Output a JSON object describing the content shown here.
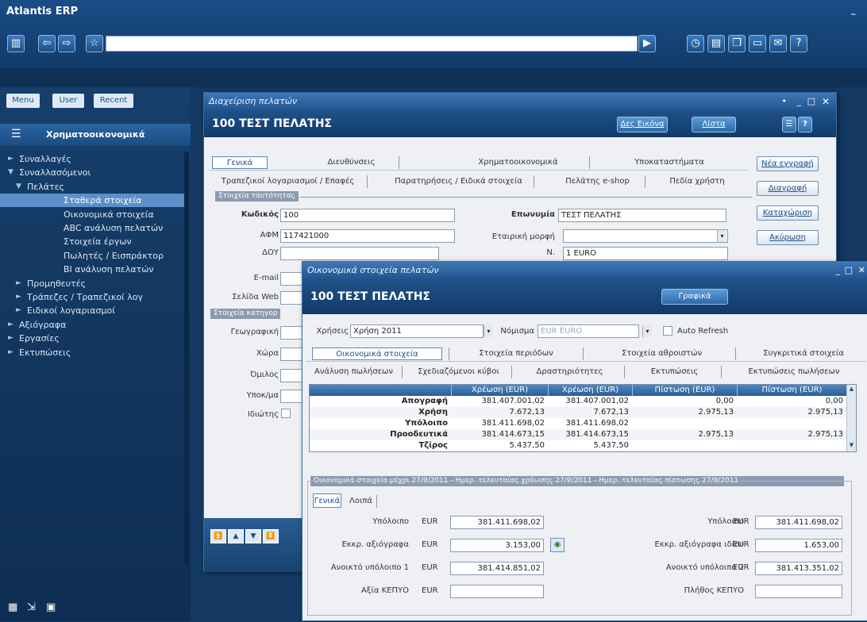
{
  "app": {
    "title": "Atlantis ERP",
    "minimize": "_"
  },
  "toolbar": {
    "panel_icon": "panel-icon",
    "back_icon": "back-arrow-icon",
    "forward_icon": "forward-arrow-icon",
    "favorite_icon": "star-icon",
    "address_value": "",
    "go_icon": "play-icon",
    "right_icons": [
      "clock-icon",
      "document-icon",
      "windows-icon",
      "monitor-icon",
      "mail-icon",
      "help-icon"
    ]
  },
  "sidebar": {
    "tabs": [
      "Menu",
      "User",
      "Recent"
    ],
    "section": "Χρηματοοικονομικά",
    "items": [
      {
        "label": "Συναλλαγές",
        "level": 0,
        "arrow": "►"
      },
      {
        "label": "Συναλλασόμενοι",
        "level": 0,
        "arrow": "▼"
      },
      {
        "label": "Πελάτες",
        "level": 1,
        "arrow": "▼"
      },
      {
        "label": "Σταθερά στοιχεία",
        "level": 2,
        "arrow": "",
        "selected": true
      },
      {
        "label": "Οικονομικά στοιχεία",
        "level": 2,
        "arrow": ""
      },
      {
        "label": "ABC ανάλυση πελατών",
        "level": 2,
        "arrow": ""
      },
      {
        "label": "Στοιχεία έργων",
        "level": 2,
        "arrow": ""
      },
      {
        "label": "Πωλητές / Εισπράκτορ",
        "level": 2,
        "arrow": ""
      },
      {
        "label": "BI ανάλυση πελατών",
        "level": 2,
        "arrow": ""
      },
      {
        "label": "Προμηθευτές",
        "level": 1,
        "arrow": "►"
      },
      {
        "label": "Τράπεζες / Τραπεζικοί λογ",
        "level": 1,
        "arrow": "►"
      },
      {
        "label": "Ειδικοί λογαριασμοί",
        "level": 1,
        "arrow": "►"
      },
      {
        "label": "Αξιόγραφα",
        "level": 0,
        "arrow": "►"
      },
      {
        "label": "Εργασίες",
        "level": 0,
        "arrow": "►"
      },
      {
        "label": "Εκτυπώσεις",
        "level": 0,
        "arrow": "►"
      }
    ],
    "bottom_icons": [
      "tree-icon",
      "export-icon",
      "grid-icon"
    ]
  },
  "customer_window": {
    "title": "Διαχείριση πελατών",
    "header": "100 ΤΕΣΤ ΠΕΛΑΤΗΣ",
    "btn_image": "Δες Εικόνα",
    "btn_list": "Λίστα",
    "tabs_row1": [
      "Γενικά",
      "Διευθύνσεις",
      "Χρηματοοικονομικά",
      "Υποκαταστήματα"
    ],
    "tabs_row2": [
      "Τραπεζικοί λογαριασμοί / Επαφές",
      "Παρατηρήσεις / Ειδικά στοιχεία",
      "Πελάτης e-shop",
      "Πεδία χρήστη"
    ],
    "section_identity": "Στοιχεία ταυτότητας",
    "section_category": "Στοιχεία κατηγορ",
    "fields": {
      "code_label": "Κωδικός",
      "code_value": "100",
      "name_label": "Επωνυμία",
      "name_value": "ΤΕΣΤ ΠΕΛΑΤΗΣ",
      "afm_label": "ΑΦΜ",
      "afm_value": "117421000",
      "form_label": "Εταιρική μορφή",
      "form_value": "",
      "doy_label": "ΔΟΥ",
      "doy_value": "",
      "currency_label": "Ν.",
      "currency_value": "1 EURO",
      "email_label": "E-mail",
      "web_label": "Σελίδα Web",
      "geo_label": "Γεωγραφική",
      "region_label": "Χώρα",
      "group_label": "Όμιλος",
      "sub_label": "Υποκ/μα",
      "special_label": "Ιδιώτης"
    },
    "right_buttons": [
      "Νέα εγγραφή",
      "Διαγραφή",
      "Καταχώριση",
      "Ακύρωση"
    ],
    "nav_icons": [
      "first-icon",
      "prev-icon",
      "next-icon",
      "last-icon"
    ]
  },
  "finance_window": {
    "title": "Οικονομικά στοιχεία πελατών",
    "header": "100 ΤΕΣΤ ΠΕΛΑΤΗΣ",
    "btn_chart": "Γραφικά",
    "year_label": "Χρήσεις",
    "year_value": "Χρήση 2011",
    "currency_label": "Νόμισμα",
    "currency_value": "EUR EURO",
    "auto_refresh": "Auto Refresh",
    "tabs_row1": [
      "Οικονομικά στοιχεία",
      "Στοιχεία περιόδων",
      "Στοιχεία αθροιστών",
      "Συγκριτικά στοιχεία"
    ],
    "tabs_row2": [
      "Ανάλυση πωλήσεων",
      "Σχεδιαζόμενοι κύβοι",
      "Δραστηριότητες",
      "Εκτυπώσεις",
      "Εκτυπώσεις πωλήσεων"
    ],
    "grid": {
      "headers": [
        "",
        "Χρέωση (EUR)",
        "Χρέωση (EUR)",
        "Πίστωση (EUR)",
        "Πίστωση (EUR)"
      ],
      "rows": [
        [
          "Απογραφή",
          "381.407.001,02",
          "381.407.001,02",
          "0,00",
          "0,00"
        ],
        [
          "Χρήση",
          "7.672,13",
          "7.672,13",
          "2.975,13",
          "2.975,13"
        ],
        [
          "Υπόλοιπο",
          "381.411.698,02",
          "381.411.698,02",
          "",
          ""
        ],
        [
          "Προοδευτικά",
          "381.414.673,15",
          "381.414.673,15",
          "2.975,13",
          "2.975,13"
        ],
        [
          "Τζίρος",
          "5.437,50",
          "5.437,50",
          "",
          ""
        ]
      ]
    },
    "summary_caption": "Οικονομικά στοιχεία μέχρι 27/9/2011 - Ημερ. τελευταίας χρέωσης 27/9/2011 - Ημερ. τελευταίας πίστωσης 27/9/2011",
    "subtabs": [
      "Γενικά",
      "Λοιπά"
    ],
    "left": [
      {
        "label": "Υπόλοιπο",
        "cur": "EUR",
        "value": "381.411.698,02"
      },
      {
        "label": "Εκκρ. αξιόγραφα",
        "cur": "EUR",
        "value": "3.153,00"
      },
      {
        "label": "Ανοικτό υπόλοιπο 1",
        "cur": "EUR",
        "value": "381.414.851,02"
      },
      {
        "label": "Αξία ΚΕΠΥΟ",
        "cur": "EUR",
        "value": ""
      }
    ],
    "right": [
      {
        "label": "Υπόλοιπο",
        "cur": "EUR",
        "value": "381.411.698,02"
      },
      {
        "label": "Εκκρ. αξιόγραφα ιδίου",
        "cur": "EUR",
        "value": "1.653,00"
      },
      {
        "label": "Ανοικτό υπόλοιπο 2",
        "cur": "EUR",
        "value": "381.413.351,02"
      },
      {
        "label": "Πλήθος ΚΕΠΥΟ",
        "cur": "",
        "value": ""
      }
    ]
  }
}
